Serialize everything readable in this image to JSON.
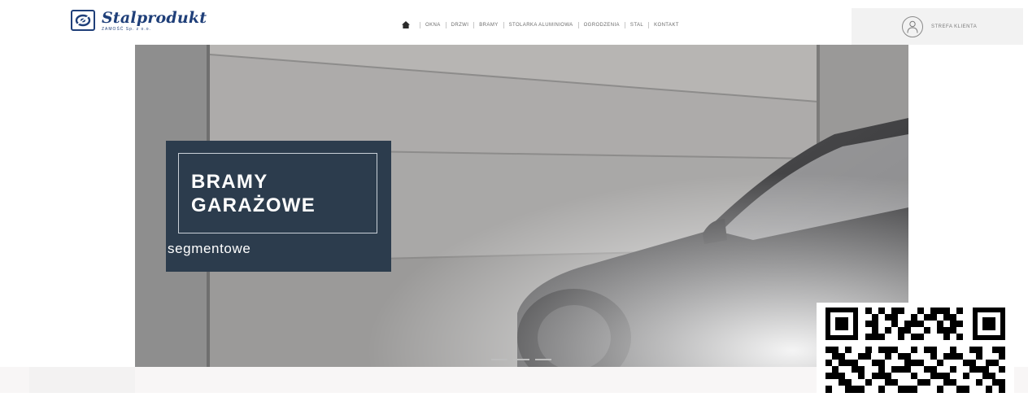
{
  "brand": {
    "name": "Stalprodukt",
    "subtitle": "ZAMOŚĆ Sp. z o.o.",
    "logo_icon": "stalprodukt-logo-icon",
    "color": "#1f3f79"
  },
  "nav": {
    "home_icon": "home-icon",
    "items": [
      "OKNA",
      "DRZWI",
      "BRAMY",
      "STOLARKA ALUMINIOWA",
      "OGRODZENIA",
      "STAL",
      "KONTAKT"
    ]
  },
  "client_zone": {
    "label": "STREFA KLIENTA",
    "icon": "user-icon"
  },
  "hero": {
    "title_line1": "BRAMY",
    "title_line2": "GARAŻOWE",
    "subtitle": "segmentowe",
    "box_color": "#2c3c4d",
    "slide_count": 3
  },
  "overlay": {
    "icon": "qr-code-icon"
  }
}
